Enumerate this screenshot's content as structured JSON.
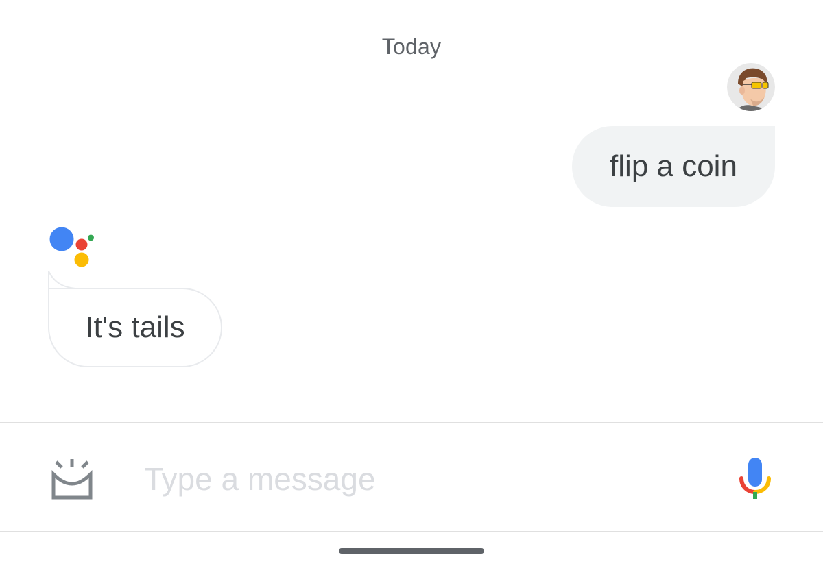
{
  "conversation": {
    "date_separator": "Today",
    "messages": [
      {
        "sender": "user",
        "text": "flip a coin",
        "avatar_icon": "user-avatar-icon"
      },
      {
        "sender": "assistant",
        "text": "It's tails",
        "avatar_icon": "google-assistant-icon"
      }
    ]
  },
  "composer": {
    "placeholder": "Type a message",
    "left_button_icon": "lens-icon",
    "right_button_icon": "mic-icon"
  },
  "colors": {
    "google_blue": "#4285F4",
    "google_red": "#EA4335",
    "google_yellow": "#FBBC05",
    "google_green": "#34A853",
    "user_bubble_bg": "#f1f3f4",
    "text": "#3c4043",
    "placeholder": "#dadce0"
  }
}
